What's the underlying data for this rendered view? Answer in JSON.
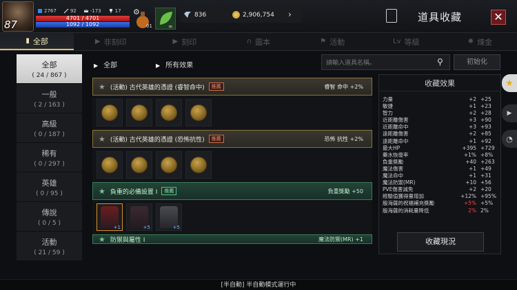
{
  "hud": {
    "level": "87",
    "stats": [
      {
        "icon": "power-icon",
        "value": "2767"
      },
      {
        "icon": "sword-icon",
        "value": "92"
      },
      {
        "icon": "crown-icon",
        "value": "-173"
      },
      {
        "icon": "trophy-icon",
        "value": "17"
      }
    ],
    "hp": "4701 / 4701",
    "mp": "1092 / 1092",
    "potion_count": "01",
    "infinite": "∞",
    "diamonds": "836",
    "gold": "2,906,754"
  },
  "page_title": "道具收藏",
  "tabs": [
    {
      "label": "全部",
      "icon": "book-icon",
      "active": true
    },
    {
      "label": "非刻印",
      "icon": "arrow-icon",
      "active": false
    },
    {
      "label": "刻印",
      "icon": "arrow-icon",
      "active": false
    },
    {
      "label": "圖本",
      "icon": "magnet-icon",
      "active": false
    },
    {
      "label": "活動",
      "icon": "flag-icon",
      "active": false
    },
    {
      "label": "等級",
      "icon": "level-icon",
      "active": false
    },
    {
      "label": "煉金",
      "icon": "gear-icon",
      "active": false
    }
  ],
  "sidebar": [
    {
      "name": "全部",
      "count": "( 24 / 867 )",
      "active": true
    },
    {
      "name": "一般",
      "count": "( 2 / 163 )"
    },
    {
      "name": "高級",
      "count": "( 0 / 187 )"
    },
    {
      "name": "稀有",
      "count": "( 0 / 297 )"
    },
    {
      "name": "英雄",
      "count": "( 0 / 95 )"
    },
    {
      "name": "傳說",
      "count": "( 0 / 5 )"
    },
    {
      "name": "活動",
      "count": "( 21 / 59 )"
    }
  ],
  "filter": {
    "category": "全部",
    "effect": "所有效果"
  },
  "search": {
    "placeholder": "請輸入道具名稱。"
  },
  "reset_label": "初始化",
  "collections": [
    {
      "title": "(活動) 古代英雄的憑證 (睿智命中)",
      "tag": "推薦",
      "effect": "睿智 命中 +2%",
      "style": "gold",
      "items": [
        "medal",
        "medal",
        "medal",
        "medal"
      ]
    },
    {
      "title": "(活動) 古代英雄的憑證 (恐怖抗性)",
      "tag": "推薦",
      "effect": "恐怖 抗性 +2%",
      "style": "gold",
      "items": [
        "medal",
        "medal",
        "medal",
        "medal"
      ]
    },
    {
      "title": "負重的必備設置 I",
      "tag": "推薦",
      "effect": "負重獎勵 +50",
      "style": "green",
      "items": [
        "armor-red",
        "armor",
        "armor-grey"
      ]
    }
  ],
  "item_plus": [
    "+1",
    "+5",
    "+5"
  ],
  "partial_row": {
    "title": "防禦與屬性 I",
    "effect": "魔法防禦(MR) +1"
  },
  "effects_panel": {
    "title": "收藏效果",
    "rows": [
      {
        "name": "力量",
        "v1": "+2",
        "v2": "+25"
      },
      {
        "name": "敏捷",
        "v1": "+1",
        "v2": "+23"
      },
      {
        "name": "智力",
        "v1": "+2",
        "v2": "+28"
      },
      {
        "name": "近距離傷害",
        "v1": "+3",
        "v2": "+90"
      },
      {
        "name": "近距離命中",
        "v1": "+3",
        "v2": "+93"
      },
      {
        "name": "遠距離傷害",
        "v1": "+2",
        "v2": "+85"
      },
      {
        "name": "遠距離命中",
        "v1": "+1",
        "v2": "+92"
      },
      {
        "name": "最大HP",
        "v1": "+395",
        "v2": "+729"
      },
      {
        "name": "藥水恢復率",
        "v1": "+1%",
        "v2": "+8%"
      },
      {
        "name": "負重獎勵",
        "v1": "+40",
        "v2": "+263"
      },
      {
        "name": "魔法傷害",
        "v1": "+1",
        "v2": "+49"
      },
      {
        "name": "魔法命中",
        "v1": "+1",
        "v2": "+31"
      },
      {
        "name": "魔法防禦(MR)",
        "v1": "+10",
        "v2": "+56"
      },
      {
        "name": "PVE傷害減免",
        "v1": "+2",
        "v2": "+20"
      },
      {
        "name": "經驗值獲得量增加",
        "v1": "+12%",
        "v2": "+95%"
      },
      {
        "name": "殷海薩的祝福補充獎勵",
        "v1": "+5%",
        "v2": "+5%",
        "red": true
      },
      {
        "name": "殷海薩的消耗量降低",
        "v1": "2%",
        "v2": "2%",
        "red": true
      }
    ],
    "button": "收藏現況"
  },
  "bottom_status": "[半自動] 半自動模式運行中",
  "colors": {
    "accent": "#e0c060",
    "close": "#6a1a1e",
    "green_row": "#224437"
  }
}
